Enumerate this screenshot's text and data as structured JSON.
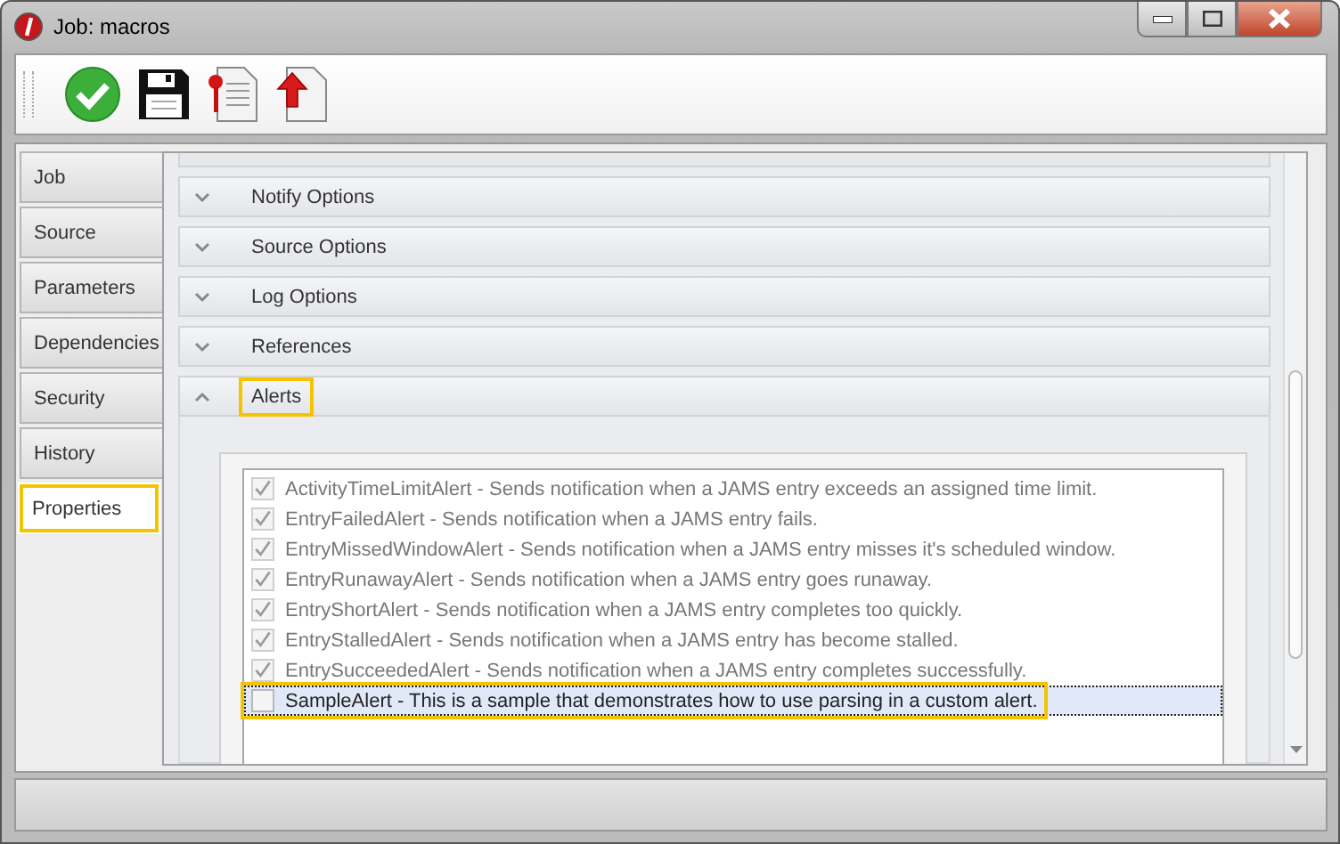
{
  "window": {
    "title": "Job: macros"
  },
  "tabs": [
    {
      "label": "Job",
      "selected": false,
      "highlighted": false
    },
    {
      "label": "Source",
      "selected": false,
      "highlighted": false
    },
    {
      "label": "Parameters",
      "selected": false,
      "highlighted": false
    },
    {
      "label": "Dependencies",
      "selected": false,
      "highlighted": false
    },
    {
      "label": "Security",
      "selected": false,
      "highlighted": false
    },
    {
      "label": "History",
      "selected": false,
      "highlighted": false
    },
    {
      "label": "Properties",
      "selected": true,
      "highlighted": true
    }
  ],
  "groups": [
    {
      "label": "Notify Options",
      "expanded": false,
      "highlighted": false
    },
    {
      "label": "Source Options",
      "expanded": false,
      "highlighted": false
    },
    {
      "label": "Log Options",
      "expanded": false,
      "highlighted": false
    },
    {
      "label": "References",
      "expanded": false,
      "highlighted": false
    },
    {
      "label": "Alerts",
      "expanded": true,
      "highlighted": true
    }
  ],
  "alerts": [
    {
      "text": "ActivityTimeLimitAlert - Sends notification when a JAMS entry exceeds an assigned time limit.",
      "checked": true,
      "disabled": true,
      "selected": false,
      "highlighted": false
    },
    {
      "text": "EntryFailedAlert - Sends notification when a JAMS entry fails.",
      "checked": true,
      "disabled": true,
      "selected": false,
      "highlighted": false
    },
    {
      "text": "EntryMissedWindowAlert - Sends notification when a JAMS entry misses it's scheduled window.",
      "checked": true,
      "disabled": true,
      "selected": false,
      "highlighted": false
    },
    {
      "text": "EntryRunawayAlert - Sends notification when a JAMS entry goes runaway.",
      "checked": true,
      "disabled": true,
      "selected": false,
      "highlighted": false
    },
    {
      "text": "EntryShortAlert - Sends notification when a JAMS entry completes too quickly.",
      "checked": true,
      "disabled": true,
      "selected": false,
      "highlighted": false
    },
    {
      "text": "EntryStalledAlert - Sends notification when a JAMS entry has become stalled.",
      "checked": true,
      "disabled": true,
      "selected": false,
      "highlighted": false
    },
    {
      "text": "EntrySucceededAlert - Sends notification when a JAMS entry completes successfully.",
      "checked": true,
      "disabled": true,
      "selected": false,
      "highlighted": false
    },
    {
      "text": "SampleAlert - This is a sample that demonstrates how to use parsing in a custom alert.",
      "checked": false,
      "disabled": false,
      "selected": true,
      "highlighted": true
    }
  ]
}
